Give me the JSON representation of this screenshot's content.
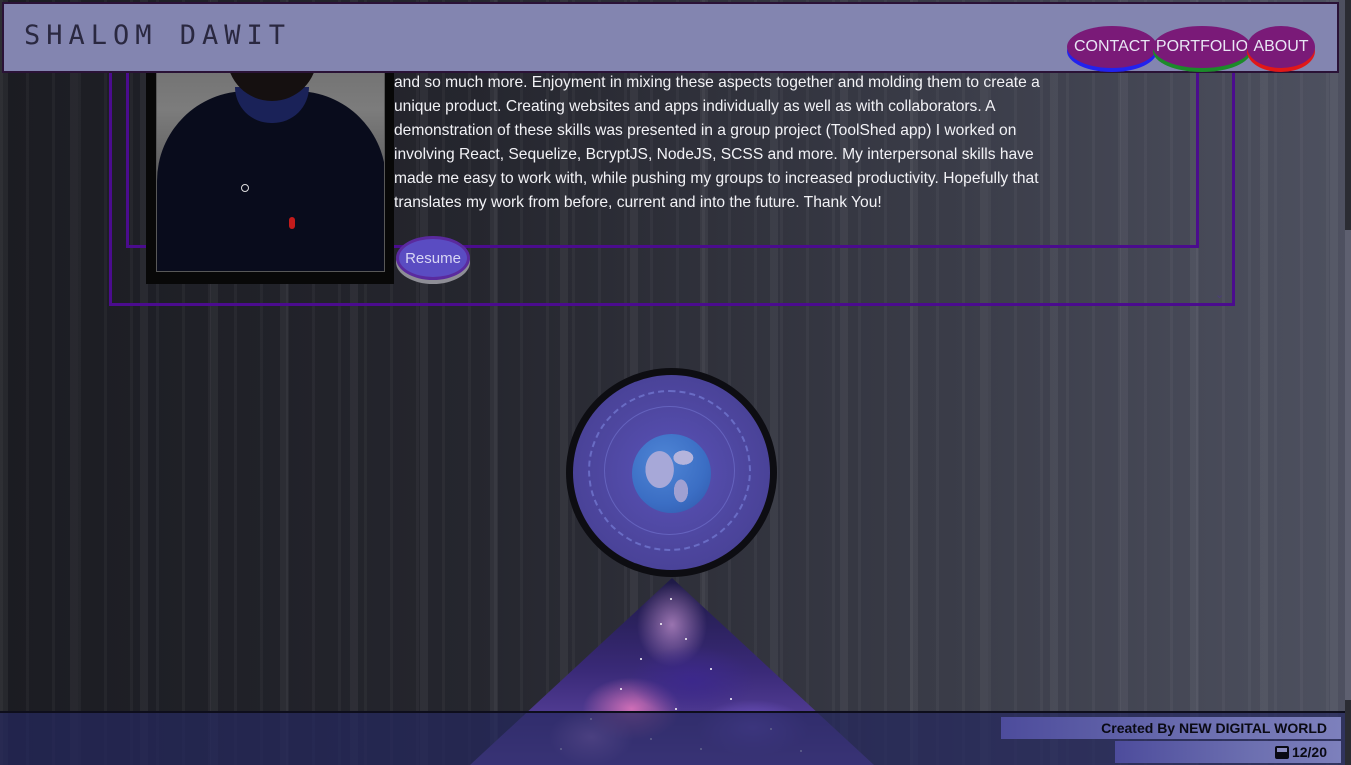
{
  "header": {
    "brand": "SHALOM DAWIT",
    "nav": [
      {
        "label": "CONTACT"
      },
      {
        "label": "PORTFOLIO"
      },
      {
        "label": "ABOUT"
      }
    ]
  },
  "about": {
    "bio": "and so much more. Enjoyment in mixing these aspects together and molding them to create a unique product. Creating websites and apps individually as well as with collaborators. A demonstration of these skills was presented in a group project (ToolShed app) I worked on involving React, Sequelize, BcryptJS, NodeJS, SCSS and more. My interpersonal skills have made me easy to work with, while pushing my groups to increased productivity. Hopefully that translates my work from before, current and into the future. Thank You!",
    "resume_label": "Resume"
  },
  "footer": {
    "credit": "Created By NEW DIGITAL WORLD",
    "date": "12/20"
  },
  "colors": {
    "header_bg": "#8385b0",
    "nav_button": "#7a1a78",
    "frame": "#4b0c8e",
    "resume_button": "#5a4cc2",
    "footer_bg": "#26285e"
  },
  "icons": [
    "bus-icon",
    "globe-icon",
    "chevron-down-icon"
  ]
}
